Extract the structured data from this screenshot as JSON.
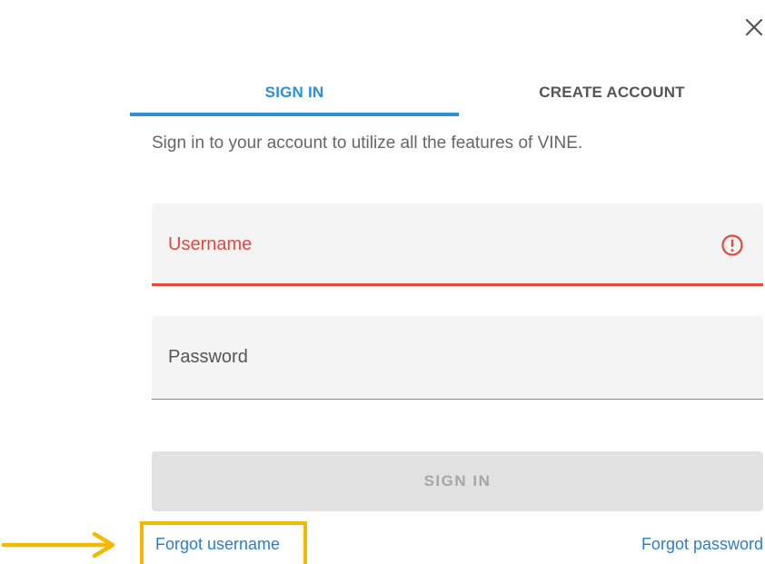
{
  "dialog": {
    "close_icon": "close-icon"
  },
  "tabs": [
    {
      "label": "SIGN IN",
      "active": true
    },
    {
      "label": "CREATE ACCOUNT",
      "active": false
    }
  ],
  "subtitle": "Sign in to your account to utilize all the features of VINE.",
  "form": {
    "username": {
      "label": "Username",
      "value": "",
      "state": "error",
      "icon": "error-icon"
    },
    "password": {
      "label": "Password",
      "value": ""
    },
    "submit_label": "SIGN IN",
    "submit_disabled": true
  },
  "links": {
    "forgot_username": "Forgot username",
    "forgot_password": "Forgot password"
  },
  "annotation": {
    "highlight": "forgot_username",
    "icon": "arrow-right-icon"
  },
  "colors": {
    "accent": "#2d8fd5",
    "error": "#e8473b",
    "link": "#2d7fc4",
    "highlight": "#f5b800",
    "disabled_bg": "#e2e2e2",
    "disabled_text": "#a6a6a6"
  }
}
